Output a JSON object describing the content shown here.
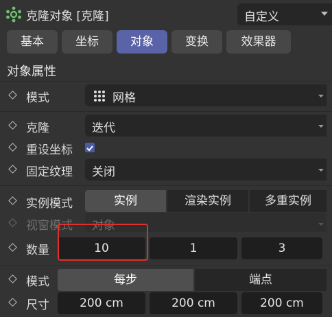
{
  "header": {
    "title": "克隆对象 [克隆]",
    "preset": "自定义"
  },
  "tabs": [
    {
      "label": "基本"
    },
    {
      "label": "坐标"
    },
    {
      "label": "对象"
    },
    {
      "label": "变换"
    },
    {
      "label": "效果器"
    }
  ],
  "active_tab": "对象",
  "section_title": "对象属性",
  "rows": {
    "mode": {
      "label": "模式",
      "value": "网格"
    },
    "clone": {
      "label": "克隆",
      "value": "迭代"
    },
    "reset_coords": {
      "label": "重设坐标",
      "checked": true
    },
    "fixed_texture": {
      "label": "固定纹理",
      "value": "关闭"
    },
    "instance_mode": {
      "label": "实例模式",
      "options": [
        "实例",
        "渲染实例",
        "多重实例"
      ],
      "selected": "实例"
    },
    "viewport_mode": {
      "label": "视窗模式",
      "value": "对象"
    },
    "count": {
      "label": "数量",
      "values": [
        "10",
        "1",
        "3"
      ]
    },
    "mode2": {
      "label": "模式",
      "options": [
        "每步",
        "端点"
      ],
      "selected": "每步"
    },
    "size": {
      "label": "尺寸",
      "values": [
        "200 cm",
        "200 cm",
        "200 cm"
      ]
    }
  },
  "colors": {
    "accent": "#5a63a8",
    "highlight": "#e0302a",
    "background": "#333333"
  }
}
